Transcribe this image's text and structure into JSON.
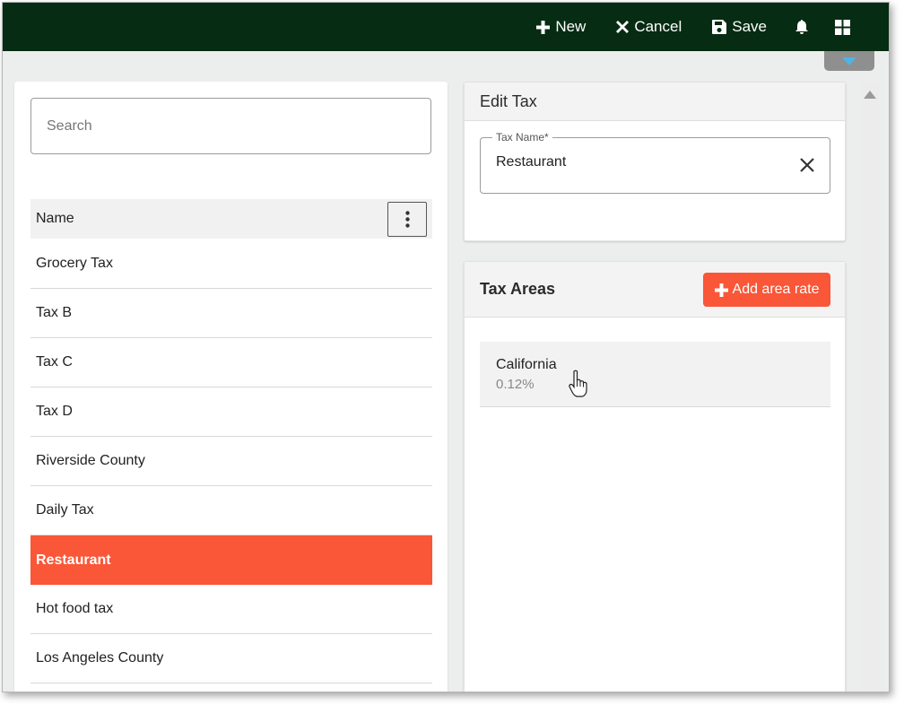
{
  "toolbar": {
    "new_label": "New",
    "cancel_label": "Cancel",
    "save_label": "Save"
  },
  "search": {
    "placeholder": "Search"
  },
  "list": {
    "header": "Name",
    "items": [
      "Grocery Tax",
      "Tax B",
      "Tax C",
      "Tax D",
      "Riverside County",
      "Daily Tax",
      "Restaurant",
      "Hot food tax",
      "Los Angeles County"
    ],
    "selected": "Restaurant"
  },
  "edit_tax": {
    "title": "Edit Tax",
    "field_label": "Tax Name*",
    "field_value": "Restaurant"
  },
  "tax_areas": {
    "title": "Tax Areas",
    "add_label": "Add area rate",
    "items": [
      {
        "name": "California",
        "rate": "0.12%"
      }
    ]
  },
  "colors": {
    "topbar": "#062c13",
    "accent": "#fa5638"
  }
}
